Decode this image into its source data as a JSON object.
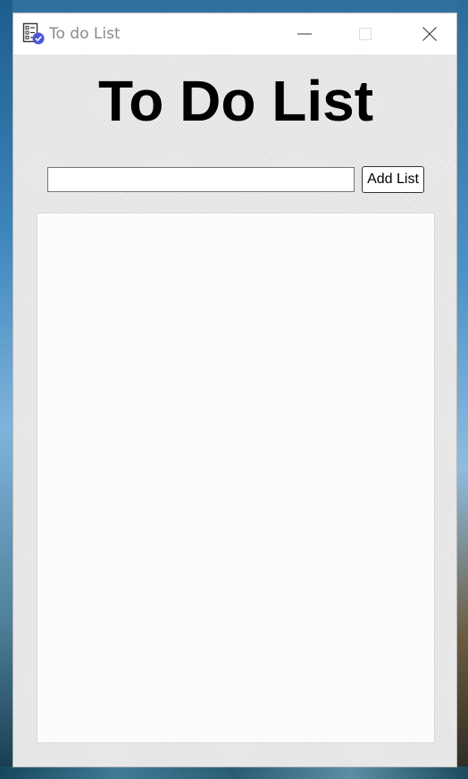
{
  "window": {
    "title": "To do List",
    "app_icon": "checklist-icon",
    "controls": {
      "minimize_icon": "minimize-icon",
      "maximize_icon": "maximize-icon",
      "close_icon": "close-icon"
    }
  },
  "main": {
    "heading": "To Do List",
    "input": {
      "value": "",
      "placeholder": ""
    },
    "add_button_label": "Add List",
    "list_items": []
  },
  "colors": {
    "accent": "#4a55d9",
    "heading": "#000000",
    "title_text": "#8a8a8a"
  }
}
